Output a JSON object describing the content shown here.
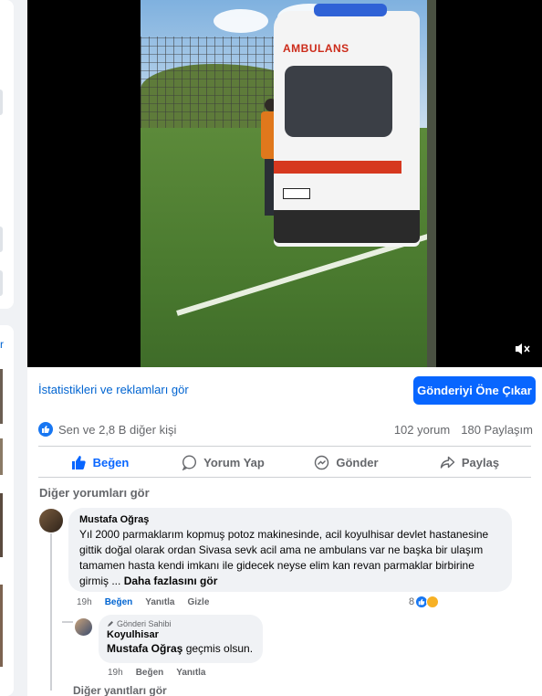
{
  "left_sidebar": {
    "link_glyph": "r"
  },
  "video": {
    "vehicle_label": "AMBULANS",
    "mute_icon": "speaker-muted-icon"
  },
  "post_actions": {
    "insights_link": "İstatistikleri ve reklamları gör",
    "boost_button": "Gönderiyi Öne Çıkar"
  },
  "reactions": {
    "summary": "Sen ve 2,8 B diğer kişi",
    "comments": "102 yorum",
    "shares": "180 Paylaşım"
  },
  "action_bar": {
    "like": "Beğen",
    "comment": "Yorum Yap",
    "send": "Gönder",
    "share": "Paylaş"
  },
  "comments_section": {
    "more_comments": "Diğer yorumları gör",
    "comment": {
      "author": "Mustafa Oğraş",
      "text": "Yıl 2000 parmaklarım kopmuş potoz makinesinde, acil koyulhisar devlet hastanesine gittik doğal olarak ordan Sivasa sevk acil ama ne ambulans var ne başka bir ulaşım tamamen hasta kendi imkanı ile gidecek neyse elim kan revan parmaklar birbirine girmiş ...",
      "see_more": "Daha fazlasını gör",
      "time": "19h",
      "like": "Beğen",
      "reply": "Yanıtla",
      "hide": "Gizle",
      "reaction_count": "8"
    },
    "reply": {
      "badge": "Gönderi Sahibi",
      "author": "Koyulhisar",
      "mention": "Mustafa Oğraş",
      "text": " geçmis olsun.",
      "time": "19h",
      "like": "Beğen",
      "reply": "Yanıtla"
    },
    "more_replies": "Diğer yanıtları gör"
  }
}
